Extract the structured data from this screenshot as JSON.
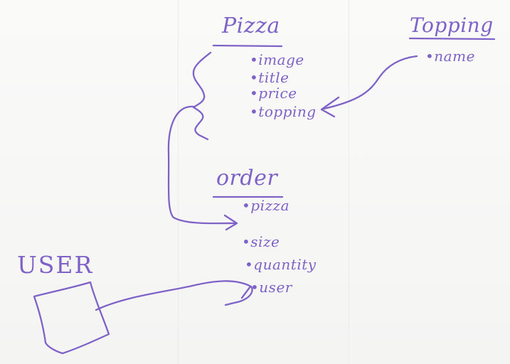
{
  "pizza": {
    "title": "Pizza",
    "fields": [
      "image",
      "title",
      "price",
      "topping"
    ]
  },
  "topping": {
    "title": "Topping",
    "fields": [
      "name"
    ]
  },
  "order": {
    "title": "order",
    "fields": [
      "pizza",
      "size",
      "quantity",
      "user"
    ]
  },
  "user": {
    "title": "USER"
  },
  "colors": {
    "ink": "#7e62c8",
    "background": "#f7f7f6"
  }
}
